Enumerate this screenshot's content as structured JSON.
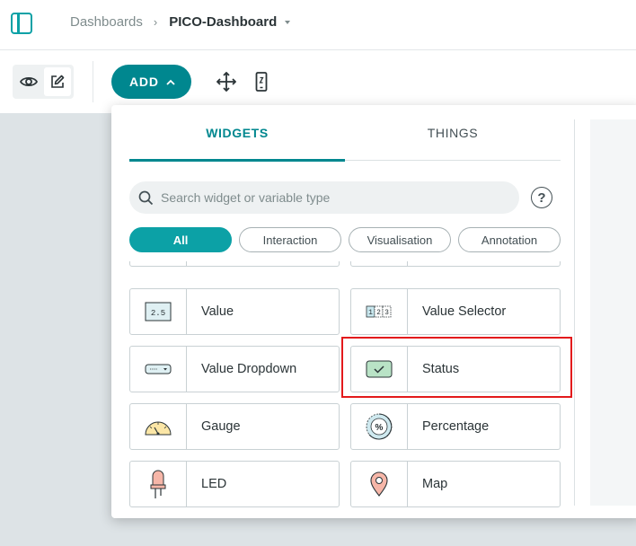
{
  "breadcrumb": {
    "parent": "Dashboards",
    "separator": "›",
    "current": "PICO-Dashboard"
  },
  "toolbar": {
    "add_label": "ADD"
  },
  "panel": {
    "tabs": [
      {
        "label": "WIDGETS",
        "active": true
      },
      {
        "label": "THINGS",
        "active": false
      }
    ],
    "search_placeholder": "Search widget or variable type",
    "help_label": "?",
    "filters": [
      {
        "label": "All",
        "active": true
      },
      {
        "label": "Interaction",
        "active": false
      },
      {
        "label": "Visualisation",
        "active": false
      },
      {
        "label": "Annotation",
        "active": false
      }
    ],
    "widgets": [
      {
        "label": "Value",
        "icon": "value-display-icon"
      },
      {
        "label": "Value Selector",
        "icon": "value-selector-icon"
      },
      {
        "label": "Value Dropdown",
        "icon": "dropdown-icon"
      },
      {
        "label": "Status",
        "icon": "status-check-icon",
        "highlighted": true
      },
      {
        "label": "Gauge",
        "icon": "gauge-icon"
      },
      {
        "label": "Percentage",
        "icon": "percentage-icon"
      },
      {
        "label": "LED",
        "icon": "led-icon"
      },
      {
        "label": "Map",
        "icon": "map-pin-icon"
      }
    ],
    "value_icon_text": "2.5",
    "selector_icon_digits": [
      "1",
      "2",
      "3"
    ],
    "percent_icon_text": "%"
  },
  "colors": {
    "accent": "#00878f",
    "accent_light": "#0ca1a6",
    "highlight": "#e31a1c",
    "canvas": "#dde3e6"
  }
}
